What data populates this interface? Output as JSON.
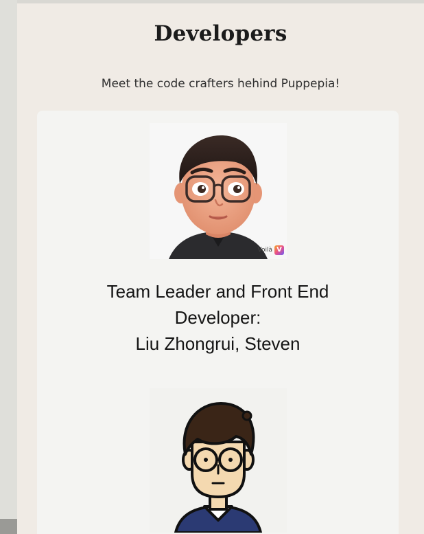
{
  "section": {
    "title": "Developers",
    "subtitle": "Meet the code crafters hehind Puppepia!"
  },
  "developers": [
    {
      "role_line1": "Team Leader and Front End",
      "role_line2": "Developer:",
      "name": "Liu Zhongrui, Steven",
      "avatar_icon": "3d-cartoon-avatar-man-glasses",
      "watermark": "Voilà"
    },
    {
      "avatar_icon": "cartoon-avatar-man-glasses"
    }
  ]
}
